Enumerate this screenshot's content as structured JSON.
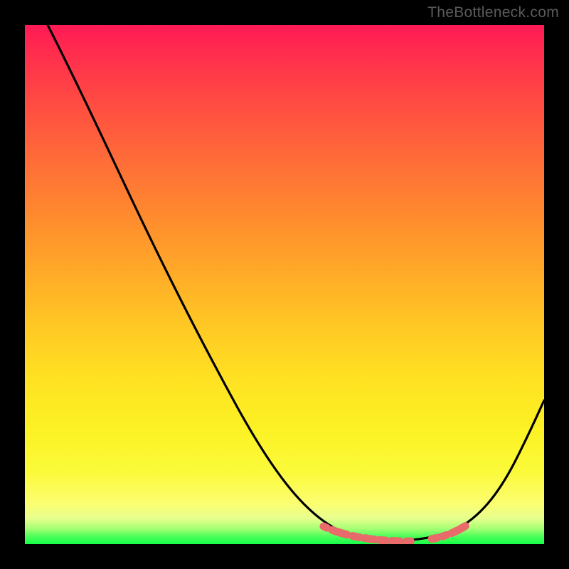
{
  "watermark": "TheBottleneck.com",
  "colors": {
    "gradient_top": "#ff1a56",
    "gradient_mid1": "#ff8b2e",
    "gradient_mid2": "#fcf224",
    "gradient_bottom": "#15ff48",
    "curve": "#000000",
    "markers": "#e96a6a",
    "background": "#000000",
    "watermark_text": "#5a5a5a"
  },
  "chart_data": {
    "type": "line",
    "title": "",
    "xlabel": "",
    "ylabel": "",
    "xlim": [
      0,
      100
    ],
    "ylim": [
      0,
      100
    ],
    "grid": false,
    "legend": false,
    "series": [
      {
        "name": "bottleneck-curve",
        "color": "#000000",
        "x": [
          4,
          10,
          20,
          30,
          40,
          50,
          58,
          63,
          68,
          73,
          78,
          82,
          86,
          90,
          94,
          100
        ],
        "values": [
          100,
          90,
          76,
          62,
          48,
          34,
          22,
          14,
          8,
          4,
          2,
          1,
          3,
          8,
          16,
          28
        ]
      }
    ],
    "annotations": [
      {
        "name": "trough-marker-band",
        "style": "dashed",
        "color": "#e96a6a",
        "x_range": [
          58,
          85
        ],
        "y_approx": 2
      }
    ],
    "background_gradient": {
      "direction": "vertical",
      "stops": [
        {
          "pos": 0.0,
          "color": "#ff1a56"
        },
        {
          "pos": 0.37,
          "color": "#ff8b2e"
        },
        {
          "pos": 0.78,
          "color": "#fcf224"
        },
        {
          "pos": 1.0,
          "color": "#15ff48"
        }
      ]
    }
  }
}
